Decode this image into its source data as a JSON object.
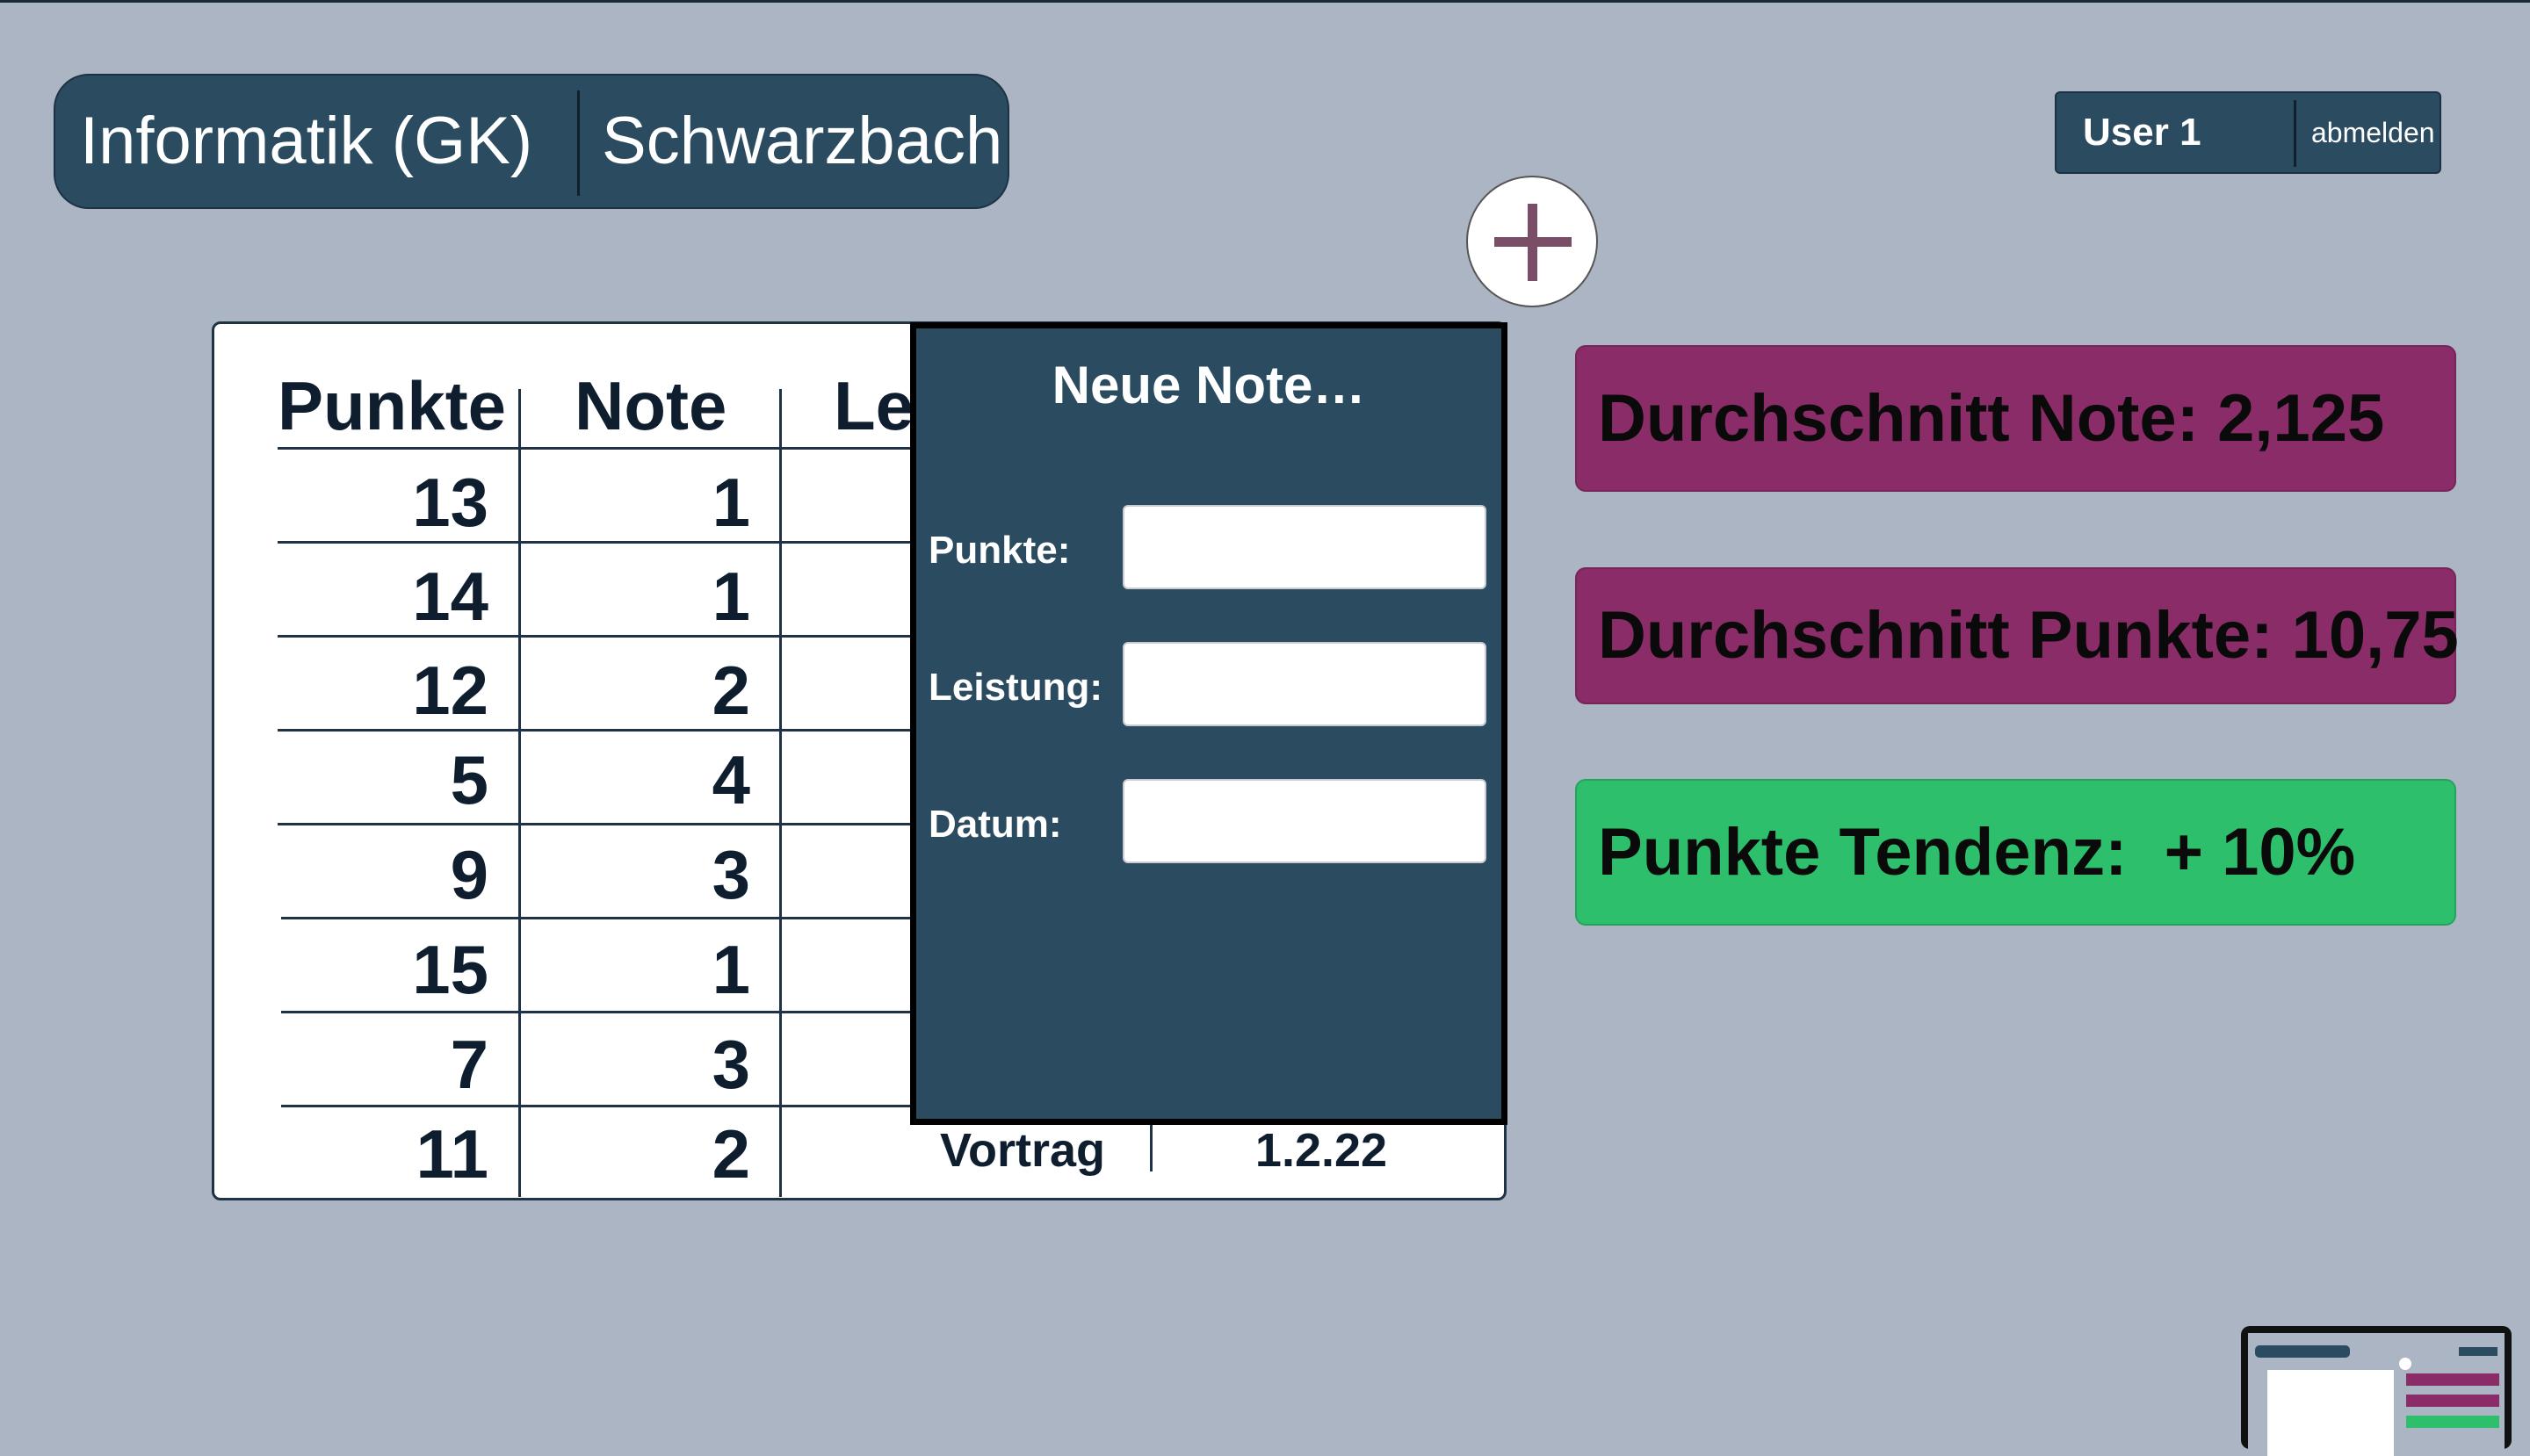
{
  "header": {
    "course_name": "Informatik (GK)",
    "teacher": "Schwarzbach"
  },
  "user": {
    "name": "User 1",
    "logout_label": "abmelden"
  },
  "add_button": {
    "icon": "plus-icon",
    "color": "#7a4e67"
  },
  "table": {
    "headers": [
      "Punkte",
      "Note",
      "Le"
    ],
    "rows": [
      {
        "punkte": "13",
        "note": "1"
      },
      {
        "punkte": "14",
        "note": "1"
      },
      {
        "punkte": "12",
        "note": "2"
      },
      {
        "punkte": "5",
        "note": "4"
      },
      {
        "punkte": "9",
        "note": "3"
      },
      {
        "punkte": "15",
        "note": "1"
      },
      {
        "punkte": "7",
        "note": "3"
      },
      {
        "punkte": "11",
        "note": "2",
        "leistung": "Vortrag",
        "datum": "1.2.22"
      }
    ]
  },
  "dialog": {
    "title": "Neue Note…",
    "fields": [
      {
        "label": "Punkte:",
        "value": ""
      },
      {
        "label": "Leistung:",
        "value": ""
      },
      {
        "label": "Datum:",
        "value": ""
      }
    ]
  },
  "stats": {
    "avg_note": "Durchschnitt Note: 2,125",
    "avg_points": "Durchschnitt Punkte: 10,75",
    "trend": "Punkte Tendenz:  + 10%"
  },
  "colors": {
    "background": "#abb5c4",
    "panel": "#2b4b60",
    "stat_purple": "#8a2c68",
    "stat_green": "#2dbf6c"
  }
}
